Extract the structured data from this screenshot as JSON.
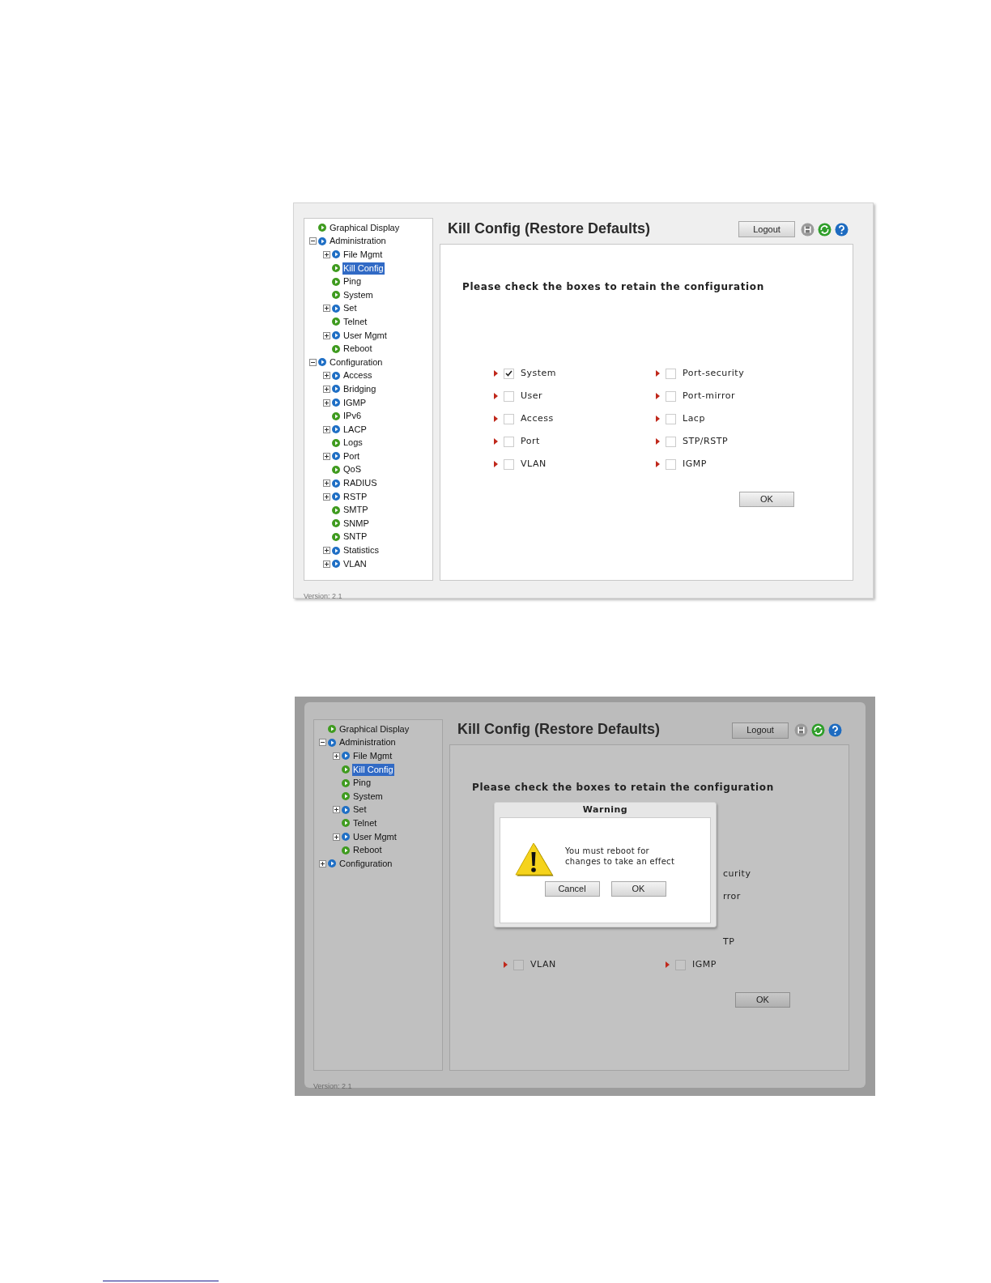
{
  "screenshots": [
    {
      "sidebar": {
        "tree": [
          {
            "label": "Graphical Display",
            "kind": "page",
            "selected": false
          },
          {
            "label": "Administration",
            "kind": "folder",
            "expanded": true,
            "selected": false,
            "children": [
              {
                "label": "File Mgmt",
                "kind": "folder",
                "expanded": false,
                "selected": false
              },
              {
                "label": "Kill Config",
                "kind": "page",
                "selected": true
              },
              {
                "label": "Ping",
                "kind": "page",
                "selected": false
              },
              {
                "label": "System",
                "kind": "page",
                "selected": false
              },
              {
                "label": "Set",
                "kind": "folder",
                "expanded": false,
                "selected": false
              },
              {
                "label": "Telnet",
                "kind": "page",
                "selected": false
              },
              {
                "label": "User Mgmt",
                "kind": "folder",
                "expanded": false,
                "selected": false
              },
              {
                "label": "Reboot",
                "kind": "page",
                "selected": false
              }
            ]
          },
          {
            "label": "Configuration",
            "kind": "folder",
            "expanded": true,
            "selected": false,
            "children": [
              {
                "label": "Access",
                "kind": "folder",
                "expanded": false,
                "selected": false
              },
              {
                "label": "Bridging",
                "kind": "folder",
                "expanded": false,
                "selected": false
              },
              {
                "label": "IGMP",
                "kind": "folder",
                "expanded": false,
                "selected": false
              },
              {
                "label": "IPv6",
                "kind": "page",
                "selected": false
              },
              {
                "label": "LACP",
                "kind": "folder",
                "expanded": false,
                "selected": false
              },
              {
                "label": "Logs",
                "kind": "page",
                "selected": false
              },
              {
                "label": "Port",
                "kind": "folder",
                "expanded": false,
                "selected": false
              },
              {
                "label": "QoS",
                "kind": "page",
                "selected": false
              },
              {
                "label": "RADIUS",
                "kind": "folder",
                "expanded": false,
                "selected": false
              },
              {
                "label": "RSTP",
                "kind": "folder",
                "expanded": false,
                "selected": false
              },
              {
                "label": "SMTP",
                "kind": "page",
                "selected": false
              },
              {
                "label": "SNMP",
                "kind": "page",
                "selected": false
              },
              {
                "label": "SNTP",
                "kind": "page",
                "selected": false
              },
              {
                "label": "Statistics",
                "kind": "folder",
                "expanded": false,
                "selected": false
              },
              {
                "label": "VLAN",
                "kind": "folder",
                "expanded": false,
                "selected": false
              }
            ]
          }
        ]
      },
      "version": "Version: 2.1",
      "title": "Kill Config (Restore Defaults)",
      "logout": "Logout",
      "instruction": "Please check the boxes to retain the configuration",
      "options": [
        {
          "left": {
            "kind": "full",
            "label": "System",
            "checked": true
          },
          "right": {
            "kind": "full",
            "label": "Port-security",
            "checked": false
          }
        },
        {
          "left": {
            "kind": "full",
            "label": "User",
            "checked": false
          },
          "right": {
            "kind": "full",
            "label": "Port-mirror",
            "checked": false
          }
        },
        {
          "left": {
            "kind": "full",
            "label": "Access",
            "checked": false
          },
          "right": {
            "kind": "full",
            "label": "Lacp",
            "checked": false
          }
        },
        {
          "left": {
            "kind": "full",
            "label": "Port",
            "checked": false
          },
          "right": {
            "kind": "full",
            "label": "STP/RSTP",
            "checked": false
          }
        },
        {
          "left": {
            "kind": "full",
            "label": "VLAN",
            "checked": false
          },
          "right": {
            "kind": "full",
            "label": "IGMP",
            "checked": false
          }
        }
      ],
      "ok": "OK"
    },
    {
      "sidebar": {
        "tree": [
          {
            "label": "Graphical Display",
            "kind": "page",
            "selected": false
          },
          {
            "label": "Administration",
            "kind": "folder",
            "expanded": true,
            "selected": false,
            "children": [
              {
                "label": "File Mgmt",
                "kind": "folder",
                "expanded": false,
                "selected": false
              },
              {
                "label": "Kill Config",
                "kind": "page",
                "selected": true
              },
              {
                "label": "Ping",
                "kind": "page",
                "selected": false
              },
              {
                "label": "System",
                "kind": "page",
                "selected": false
              },
              {
                "label": "Set",
                "kind": "folder",
                "expanded": false,
                "selected": false
              },
              {
                "label": "Telnet",
                "kind": "page",
                "selected": false
              },
              {
                "label": "User Mgmt",
                "kind": "folder",
                "expanded": false,
                "selected": false
              },
              {
                "label": "Reboot",
                "kind": "page",
                "selected": false
              }
            ]
          },
          {
            "label": "Configuration",
            "kind": "folder",
            "expanded": false,
            "selected": false
          }
        ]
      },
      "version": "Version: 2.1",
      "title": "Kill Config (Restore Defaults)",
      "logout": "Logout",
      "instruction": "Please check the boxes to retain the configuration",
      "options": [
        {
          "left": {
            "kind": "covered"
          },
          "right": {
            "kind": "partial",
            "label": "curity"
          }
        },
        {
          "left": {
            "kind": "covered"
          },
          "right": {
            "kind": "partial",
            "label": "rror"
          }
        },
        {
          "left": {
            "kind": "covered"
          },
          "right": {
            "kind": "covered"
          }
        },
        {
          "left": {
            "kind": "covered"
          },
          "right": {
            "kind": "partial",
            "label": "TP"
          }
        },
        {
          "left": {
            "kind": "full",
            "label": "VLAN",
            "checked": false
          },
          "right": {
            "kind": "full",
            "label": "IGMP",
            "checked": false
          }
        }
      ],
      "ok": "OK",
      "dialog": {
        "title": "Warning",
        "message": "You must reboot for changes to take an effect",
        "cancel": "Cancel",
        "ok": "OK"
      }
    }
  ]
}
